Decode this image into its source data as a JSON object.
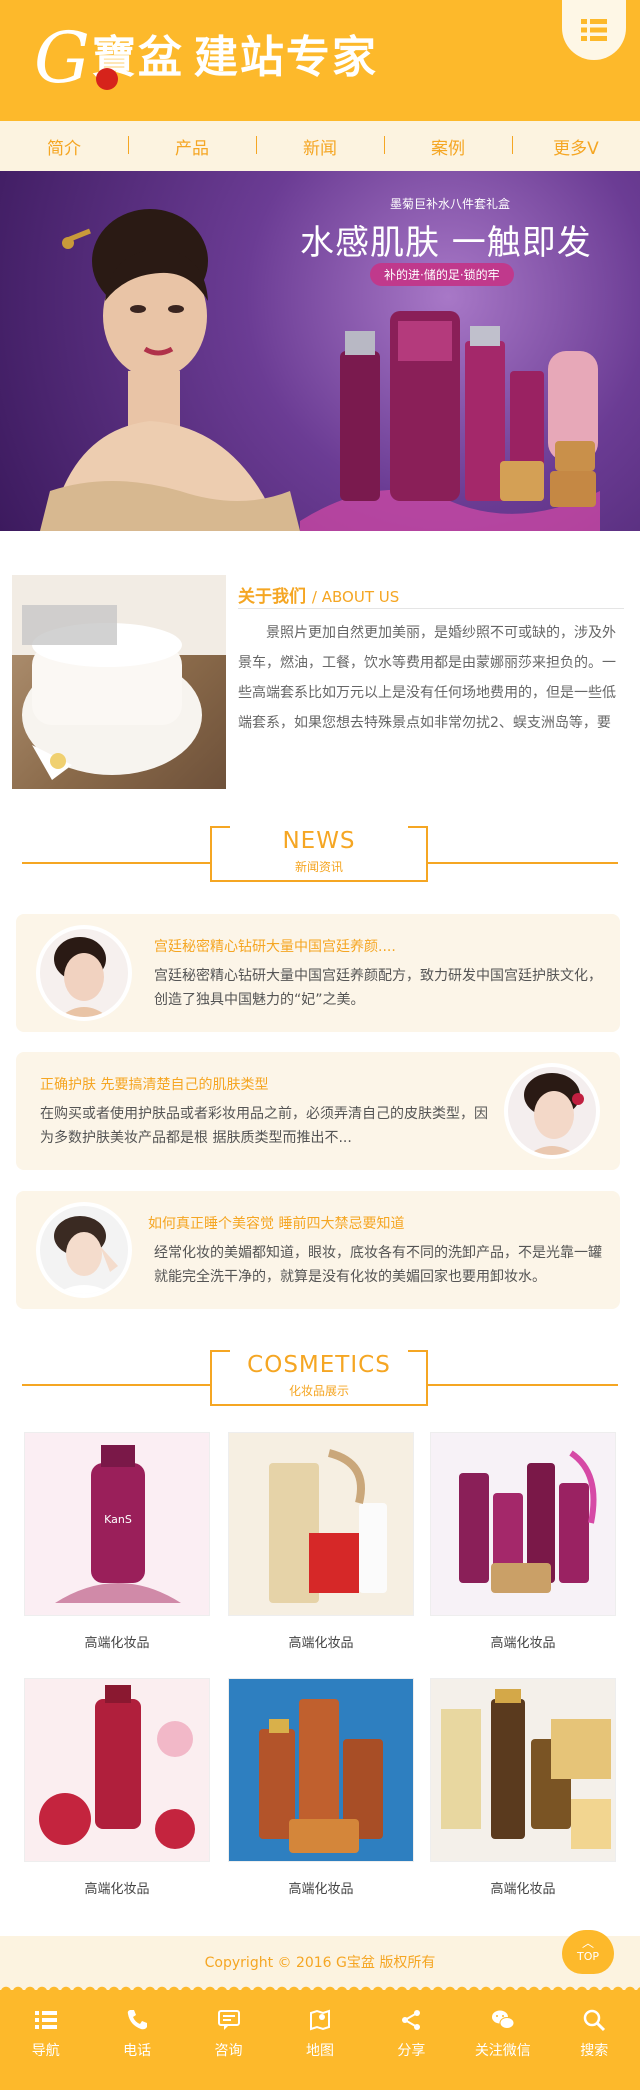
{
  "header": {
    "logo_g": "G",
    "logo_chars": "寶盆",
    "logo_sub": "建站专家",
    "menu_icon": "menu-grid-icon"
  },
  "nav": {
    "items": [
      "简介",
      "产品",
      "新闻",
      "案例",
      "更多V"
    ]
  },
  "banner": {
    "subtitle": "墨菊巨补水八件套礼盒",
    "title": "水感肌肤 一触即发",
    "tag": "补的进·储的足·锁的牢"
  },
  "about": {
    "title_cn": "关于我们",
    "title_en": "/ ABOUT US",
    "text": "景照片更加自然更加美丽，是婚纱照不可或缺的，涉及外景车，燃油，工餐，饮水等费用都是由蒙娜丽莎来担负的。一些高端套系比如万元以上是没有任何场地费用的，但是一些低端套系，如果您想去特殊景点如非常勿扰2、蜈支洲岛等，要"
  },
  "news_section": {
    "en": "NEWS",
    "cn": "新闻资讯"
  },
  "news": [
    {
      "title": "宫廷秘密精心钻研大量中国宫廷养颜....",
      "text": "宫廷秘密精心钻研大量中国宫廷养颜配方，致力研发中国宫廷护肤文化，创造了独具中国魅力的“妃”之美。"
    },
    {
      "title": "正确护肤 先要搞清楚自己的肌肤类型",
      "text": "在购买或者使用护肤品或者彩妆用品之前，必须弄清自己的皮肤类型，因为多数护肤美妆产品都是根 据肤质类型而推出不..."
    },
    {
      "title": "如何真正睡个美容觉 睡前四大禁忌要知道",
      "text": "经常化妆的美媚都知道，眼妆，底妆各有不同的洗卸产品，不是光靠一罐就能完全洗干净的，就算是没有化妆的美媚回家也要用卸妆水。"
    }
  ],
  "cosmetics_section": {
    "en": "COSMETICS",
    "cn": "化妆品展示"
  },
  "products": [
    {
      "label": "高端化妆品"
    },
    {
      "label": "高端化妆品"
    },
    {
      "label": "高端化妆品"
    },
    {
      "label": "高端化妆品"
    },
    {
      "label": "高端化妆品"
    },
    {
      "label": "高端化妆品"
    }
  ],
  "footer": {
    "copyright": "Copyright © 2016 G宝盆 版权所有",
    "top_label": "TOP"
  },
  "bottom_bar": [
    {
      "label": "导航",
      "icon": "list-icon"
    },
    {
      "label": "电话",
      "icon": "phone-icon"
    },
    {
      "label": "咨询",
      "icon": "chat-icon"
    },
    {
      "label": "地图",
      "icon": "map-icon"
    },
    {
      "label": "分享",
      "icon": "share-icon"
    },
    {
      "label": "关注微信",
      "icon": "wechat-icon"
    },
    {
      "label": "搜索",
      "icon": "search-icon"
    }
  ],
  "colors": {
    "accent": "#fdb92b",
    "accent_text": "#f5a623",
    "cream": "#fcf3e0",
    "card": "#fcf5e8"
  }
}
